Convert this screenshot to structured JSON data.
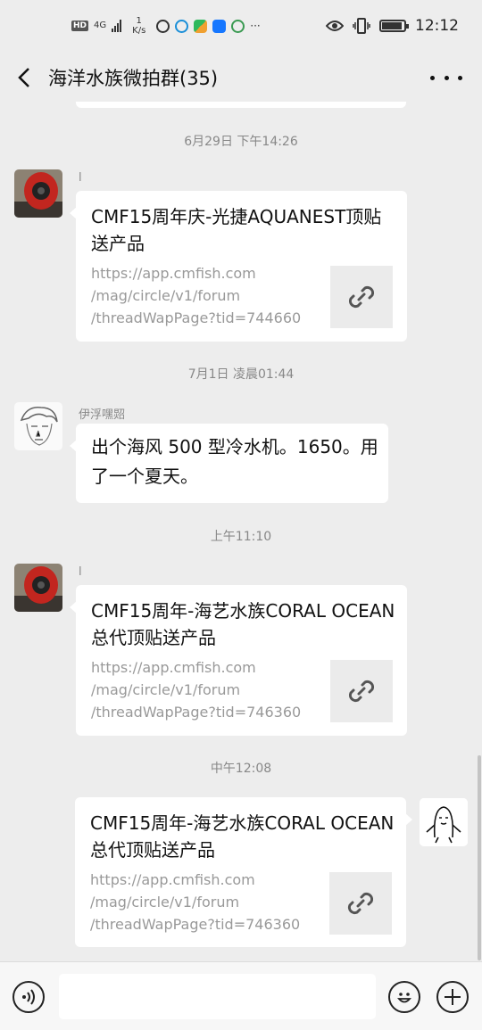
{
  "status_bar": {
    "hd": "HD",
    "network": "4G",
    "speed_value": "1",
    "speed_unit": "K/s",
    "more": "···",
    "time": "12:12"
  },
  "header": {
    "title": "海洋水族微拍群(35)"
  },
  "messages": [
    {
      "timestamp": "6月29日 下午14:26",
      "sender": "l",
      "type": "link-card",
      "side": "left",
      "title": "CMF15周年庆-光捷AQUANEST顶贴送产品",
      "desc_lines": [
        "https://app.cmfish.com",
        "/mag/circle/v1/forum",
        "/threadWapPage?tid=744660"
      ]
    },
    {
      "timestamp": "7月1日 凌晨01:44",
      "sender": "伊浮嘿㷖",
      "type": "text",
      "side": "left",
      "text": "出个海风 500 型冷水机。1650。用了一个夏天。"
    },
    {
      "timestamp": "上午11:10",
      "sender": "l",
      "type": "link-card",
      "side": "left",
      "title": "CMF15周年-海艺水族CORAL OCEAN总代顶贴送产品",
      "desc_lines": [
        "https://app.cmfish.com",
        "/mag/circle/v1/forum",
        "/threadWapPage?tid=746360"
      ]
    },
    {
      "timestamp": "中午12:08",
      "type": "link-card",
      "side": "right",
      "title": "CMF15周年-海艺水族CORAL OCEAN总代顶贴送产品",
      "desc_lines": [
        "https://app.cmfish.com",
        "/mag/circle/v1/forum",
        "/threadWapPage?tid=746360"
      ]
    }
  ],
  "input_bar": {
    "placeholder": ""
  },
  "icons": [
    "back-icon",
    "more-icon",
    "link-icon",
    "voice-icon",
    "emoji-icon",
    "add-icon"
  ],
  "colors": {
    "background": "#ededed",
    "bubble": "#ffffff",
    "timestamp": "#888888",
    "thumb": "#ebebeb"
  }
}
